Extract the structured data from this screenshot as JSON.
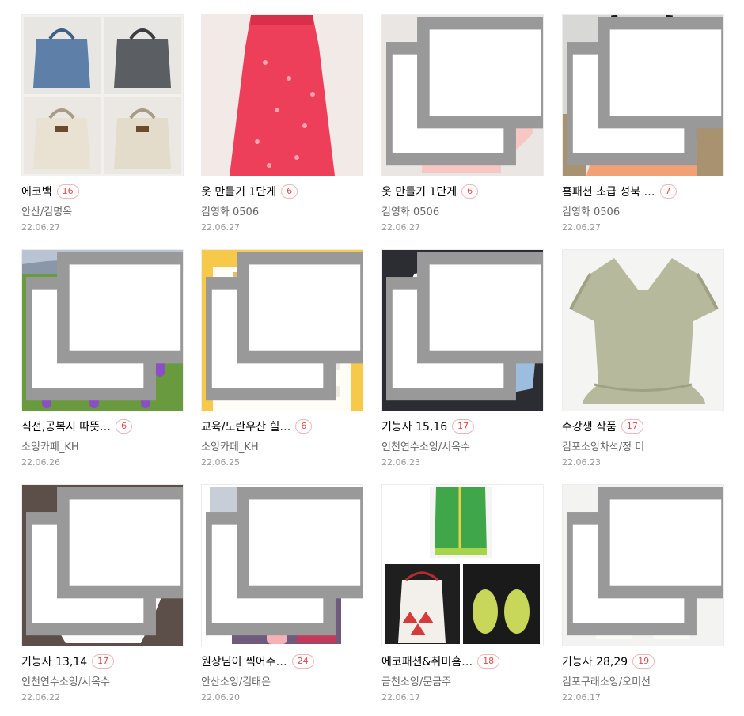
{
  "posts": [
    {
      "title": "에코백",
      "count": "16",
      "author": "안산/김명옥",
      "date": "22.06.27"
    },
    {
      "title": "옷 만들기 1단게",
      "count": "6",
      "author": "김영화 0506",
      "date": "22.06.27"
    },
    {
      "title": "옷 만들기 1단게",
      "count": "6",
      "author": "김영화 0506",
      "date": "22.06.27"
    },
    {
      "title": "홈패션 초급 성북 …",
      "count": "7",
      "author": "김영화 0506",
      "date": "22.06.27"
    },
    {
      "title": "식전,공복시 따뜻…",
      "count": "6",
      "author": "소잉카페_KH",
      "date": "22.06.26"
    },
    {
      "title": "교육/노란우산 힐…",
      "count": "6",
      "author": "소잉카페_KH",
      "date": "22.06.25"
    },
    {
      "title": "기능사 15,16",
      "count": "17",
      "author": "인천연수소잉/서옥수",
      "date": "22.06.23"
    },
    {
      "title": "수강생 작품",
      "count": "17",
      "author": "김포소잉차석/정 미",
      "date": "22.06.23"
    },
    {
      "title": "기능사 13,14",
      "count": "17",
      "author": "인천연수소잉/서옥수",
      "date": "22.06.22"
    },
    {
      "title": "원장님이 찍어주…",
      "count": "24",
      "author": "안산소잉/김태은",
      "date": "22.06.20"
    },
    {
      "title": "에코패션&취미홈…",
      "count": "18",
      "author": "금천소잉/문금주",
      "date": "22.06.17"
    },
    {
      "title": "기능사 28,29",
      "count": "19",
      "author": "김포구래소잉/오미선",
      "date": "22.06.17"
    }
  ],
  "colors": {
    "count_text": "#e24a4a",
    "count_border": "#f1b7b7",
    "author": "#666666",
    "date": "#999999"
  }
}
